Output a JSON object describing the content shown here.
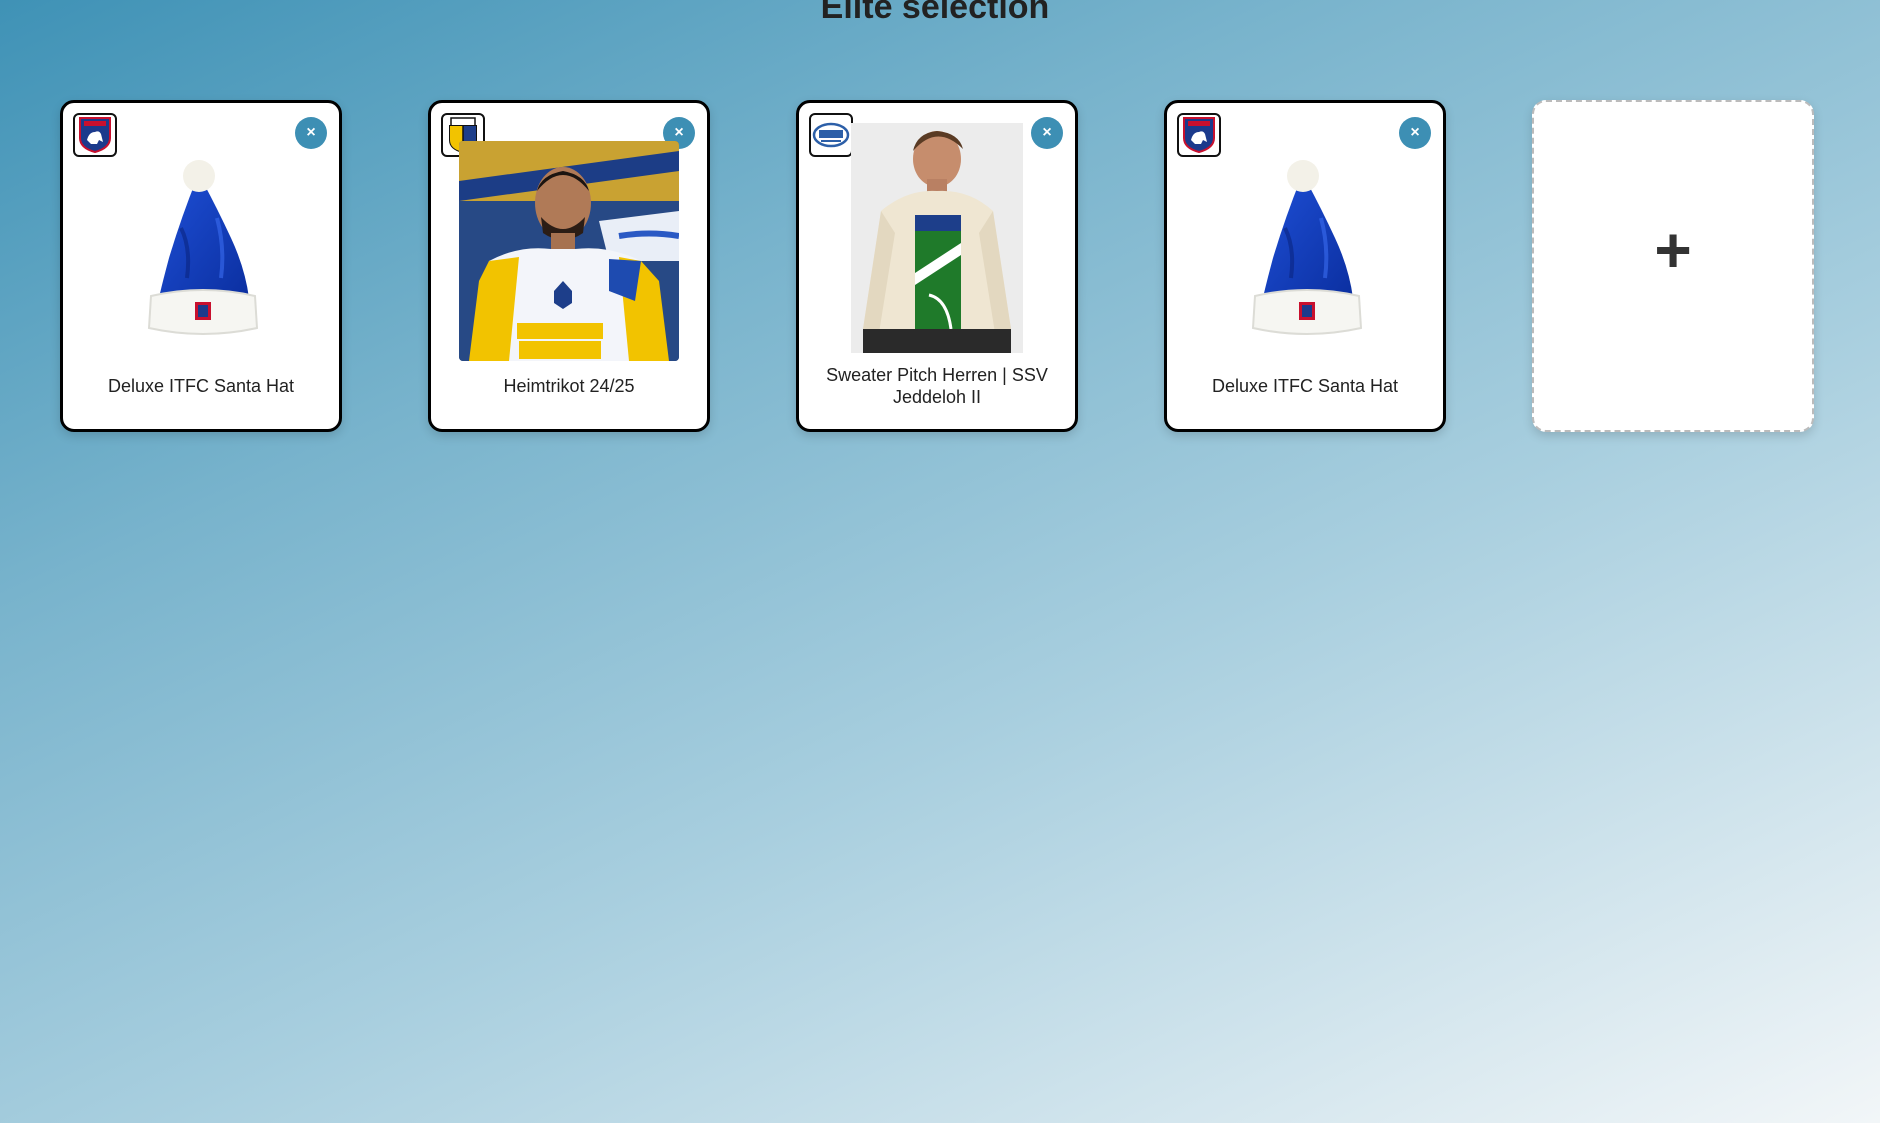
{
  "page": {
    "title": "Elite selection"
  },
  "products": [
    {
      "name": "Deluxe ITFC Santa Hat",
      "club_icon": "ipswich-crest-icon",
      "photo": "blue-santa-hat"
    },
    {
      "name": "Heimtrikot 24/25",
      "club_icon": "carl-zeiss-jena-crest-icon",
      "photo": "player-in-home-jersey"
    },
    {
      "name": "Sweater Pitch Herren | SSV Jeddeloh II",
      "club_icon": "ssv-jeddeloh-crest-icon",
      "photo": "man-in-cream-sweater"
    },
    {
      "name": "Deluxe ITFC Santa Hat",
      "club_icon": "ipswich-crest-icon",
      "photo": "blue-santa-hat"
    }
  ],
  "remove_label": "×",
  "add_label": "+",
  "colors": {
    "accent": "#3d8fb4",
    "card_border": "#000000"
  }
}
